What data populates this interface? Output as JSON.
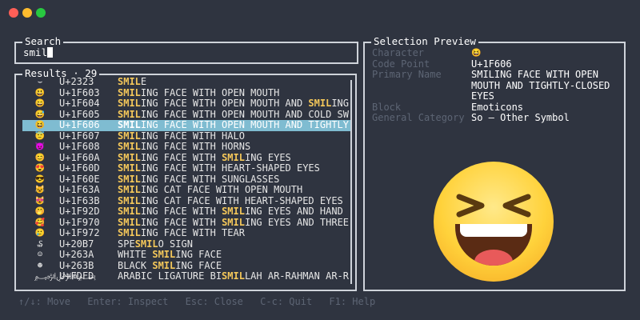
{
  "window": {
    "traffic_lights": {
      "close": "#ff5f57",
      "minimize": "#febc2e",
      "zoom": "#28c840"
    }
  },
  "search": {
    "title": "Search",
    "value": "smil"
  },
  "results": {
    "title": "Results · 29",
    "rows": [
      {
        "char": "⌣",
        "code": "U+2323",
        "pre": "",
        "hl": "SMIL",
        "post": "E",
        "selected": false
      },
      {
        "char": "😃",
        "code": "U+1F603",
        "pre": "",
        "hl": "SMIL",
        "post": "ING FACE WITH OPEN MOUTH",
        "selected": false
      },
      {
        "char": "😄",
        "code": "U+1F604",
        "pre": "",
        "hl": "SMIL",
        "post": "ING FACE WITH OPEN MOUTH AND ",
        "hl2": "SMIL",
        "post2": "ING",
        "selected": false
      },
      {
        "char": "😅",
        "code": "U+1F605",
        "pre": "",
        "hl": "SMIL",
        "post": "ING FACE WITH OPEN MOUTH AND COLD SW",
        "selected": false
      },
      {
        "char": "😆",
        "code": "U+1F606",
        "pre": "",
        "hl": "SMIL",
        "post": "ING FACE WITH OPEN MOUTH AND TIGHTLY",
        "selected": true
      },
      {
        "char": "😇",
        "code": "U+1F607",
        "pre": "",
        "hl": "SMIL",
        "post": "ING FACE WITH HALO",
        "selected": false
      },
      {
        "char": "😈",
        "code": "U+1F608",
        "pre": "",
        "hl": "SMIL",
        "post": "ING FACE WITH HORNS",
        "selected": false
      },
      {
        "char": "😊",
        "code": "U+1F60A",
        "pre": "",
        "hl": "SMIL",
        "post": "ING FACE WITH ",
        "hl2": "SMIL",
        "post2": "ING EYES",
        "selected": false
      },
      {
        "char": "😍",
        "code": "U+1F60D",
        "pre": "",
        "hl": "SMIL",
        "post": "ING FACE WITH HEART-SHAPED EYES",
        "selected": false
      },
      {
        "char": "😎",
        "code": "U+1F60E",
        "pre": "",
        "hl": "SMIL",
        "post": "ING FACE WITH SUNGLASSES",
        "selected": false
      },
      {
        "char": "😺",
        "code": "U+1F63A",
        "pre": "",
        "hl": "SMIL",
        "post": "ING CAT FACE WITH OPEN MOUTH",
        "selected": false
      },
      {
        "char": "😻",
        "code": "U+1F63B",
        "pre": "",
        "hl": "SMIL",
        "post": "ING CAT FACE WITH HEART-SHAPED EYES",
        "selected": false
      },
      {
        "char": "🤭",
        "code": "U+1F92D",
        "pre": "",
        "hl": "SMIL",
        "post": "ING FACE WITH ",
        "hl2": "SMIL",
        "post2": "ING EYES AND HAND",
        "selected": false
      },
      {
        "char": "🥰",
        "code": "U+1F970",
        "pre": "",
        "hl": "SMIL",
        "post": "ING FACE WITH ",
        "hl2": "SMIL",
        "post2": "ING EYES AND THREE",
        "selected": false
      },
      {
        "char": "🥲",
        "code": "U+1F972",
        "pre": "",
        "hl": "SMIL",
        "post": "ING FACE WITH TEAR",
        "selected": false
      },
      {
        "char": "₷",
        "code": "U+20B7",
        "pre": "SPE",
        "hl": "SMIL",
        "post": "O SIGN",
        "selected": false
      },
      {
        "char": "☺",
        "code": "U+263A",
        "pre": "WHITE ",
        "hl": "SMIL",
        "post": "ING FACE",
        "selected": false
      },
      {
        "char": "☻",
        "code": "U+263B",
        "pre": "BLACK ",
        "hl": "SMIL",
        "post": "ING FACE",
        "selected": false
      },
      {
        "char": "﷽",
        "code": "U+FDFD",
        "pre": "ARABIC LIGATURE BI",
        "hl": "SMIL",
        "post": "LAH AR-RAHMAN AR-R",
        "selected": false
      }
    ]
  },
  "preview": {
    "title": "Selection Preview",
    "character_label": "Character",
    "character_value": "😆",
    "codepoint_label": "Code Point",
    "codepoint_value": "U+1F606",
    "primary_name_label": "Primary Name",
    "primary_name_value": "SMILING FACE WITH OPEN MOUTH AND TIGHTLY-CLOSED EYES",
    "block_label": "Block",
    "block_value": "Emoticons",
    "category_label": "General Category",
    "category_value": "So — Other Symbol",
    "large_glyph_icon": "grinning-squinting-face-icon"
  },
  "footer": {
    "move": "↑/↓: Move",
    "inspect": "Enter: Inspect",
    "close": "Esc: Close",
    "quit": "C-c: Quit",
    "help": "F1: Help"
  },
  "colors": {
    "background": "#2f3440",
    "border": "#cfd3da",
    "highlight": "#f5c85a",
    "selection": "#7fbcd1",
    "muted": "#5d6574"
  }
}
